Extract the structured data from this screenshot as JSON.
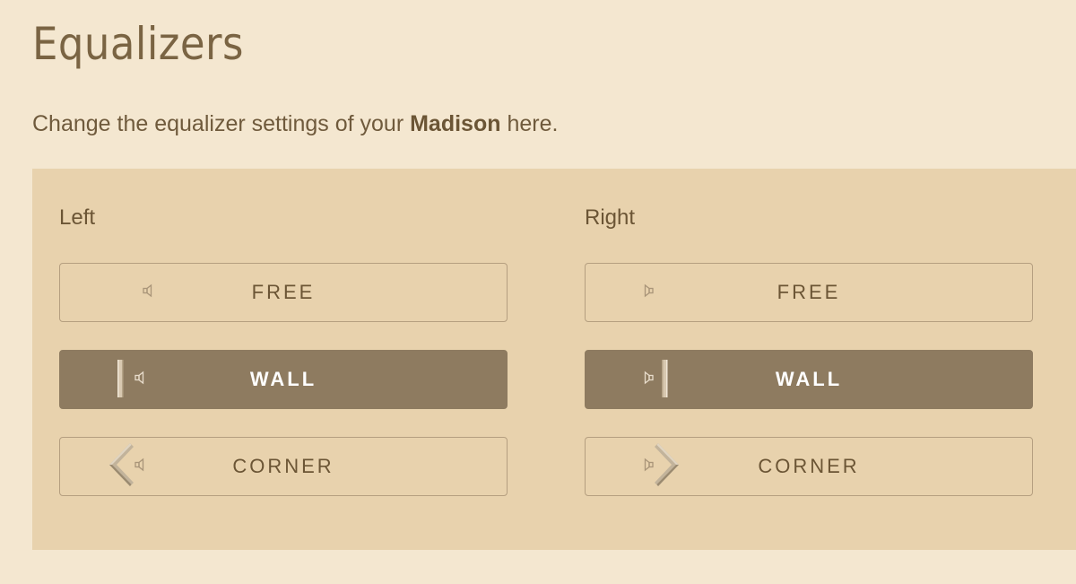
{
  "header": {
    "title": "Equalizers",
    "intro_prefix": "Change the equalizer settings of your ",
    "intro_device": "Madison",
    "intro_suffix": " here."
  },
  "left": {
    "title": "Left",
    "options": [
      {
        "label": "FREE",
        "icon": "speaker-free-icon",
        "active": false
      },
      {
        "label": "WALL",
        "icon": "speaker-wall-icon",
        "active": true
      },
      {
        "label": "CORNER",
        "icon": "speaker-corner-icon",
        "active": false
      }
    ]
  },
  "right": {
    "title": "Right",
    "options": [
      {
        "label": "FREE",
        "icon": "speaker-free-icon",
        "active": false
      },
      {
        "label": "WALL",
        "icon": "speaker-wall-icon",
        "active": true
      },
      {
        "label": "CORNER",
        "icon": "speaker-corner-icon",
        "active": false
      }
    ]
  },
  "colors": {
    "page_bg": "#f4e7d0",
    "panel_bg": "#e8d2ad",
    "active_bg": "#8e7b60",
    "text": "#6b5535"
  }
}
